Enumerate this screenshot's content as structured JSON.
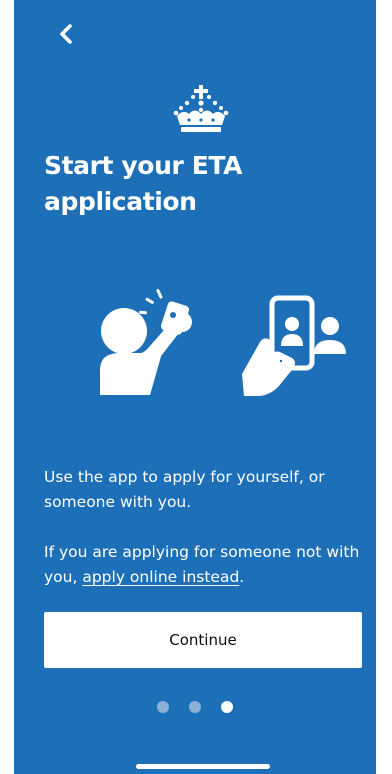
{
  "header": {
    "back_icon": "chevron-left-icon",
    "logo_icon": "crown-icon"
  },
  "main": {
    "title": "Start your ETA application",
    "illustrations": [
      "person-taking-selfie-icon",
      "phone-with-person-icon"
    ],
    "paragraph_1": "Use the app to apply for yourself, or someone with you.",
    "paragraph_2_prefix": "If you are applying for someone not with you, ",
    "paragraph_2_link": "apply online instead",
    "paragraph_2_suffix": "."
  },
  "footer": {
    "continue_label": "Continue",
    "pager": {
      "total": 3,
      "current": 3
    }
  },
  "colors": {
    "background": "#1d70b8",
    "button_background": "#ffffff",
    "button_text": "#0b0c0c",
    "dot_inactive": "#8ab0d8",
    "dot_active": "#ffffff"
  }
}
